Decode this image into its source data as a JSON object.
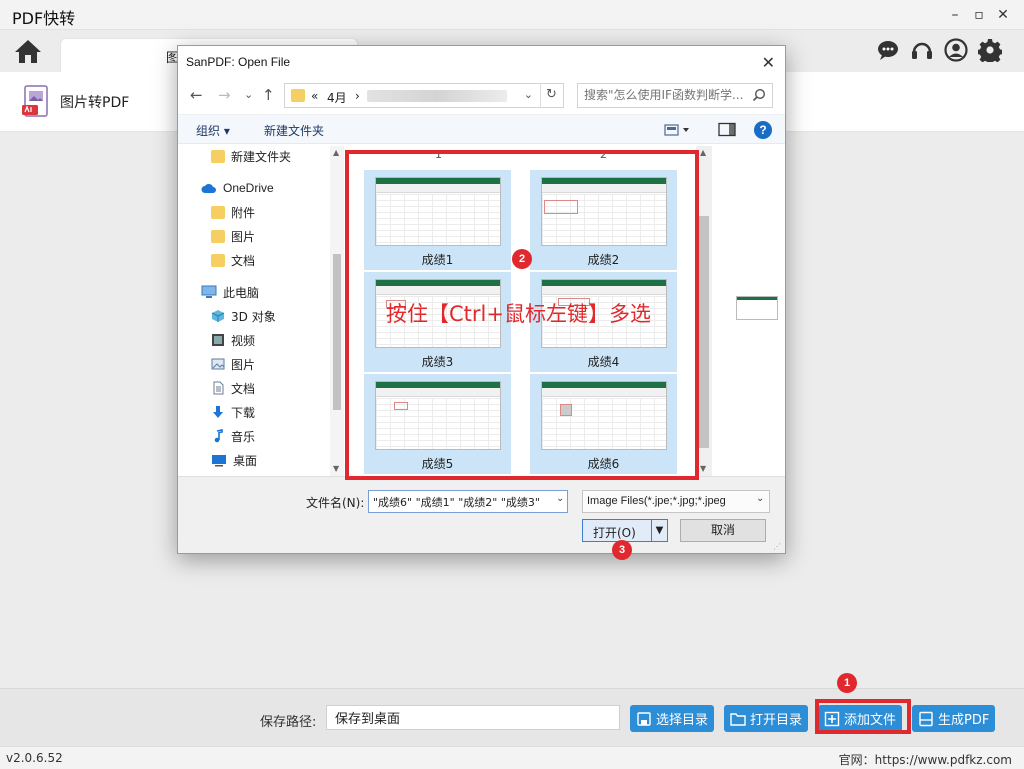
{
  "app": {
    "title": "PDF快转",
    "tab_label": "图片转PDF",
    "tool_label": "图片转PDF",
    "minimize": "–",
    "maximize": "▫",
    "close": "✕"
  },
  "dialog": {
    "title": "SanPDF: Open File",
    "close_glyph": "✕",
    "nav": {
      "back": "←",
      "forward": "→",
      "up": "↑",
      "recent": "⌄",
      "refresh": "↻"
    },
    "address": {
      "prefix": "«",
      "folder": "4月",
      "separator": "›",
      "dropdown": "⌄"
    },
    "search_placeholder": "搜索\"怎么使用IF函数判断学...",
    "commands": {
      "organize": "组织 ▾",
      "new_folder": "新建文件夹"
    },
    "sidebar": [
      {
        "label": "新建文件夹",
        "icon": "folder-icon"
      },
      {
        "label": "OneDrive",
        "icon": "cloud-icon"
      },
      {
        "label": "附件",
        "icon": "folder-icon"
      },
      {
        "label": "图片",
        "icon": "folder-icon"
      },
      {
        "label": "文档",
        "icon": "folder-icon"
      },
      {
        "label": "此电脑",
        "icon": "computer-icon"
      },
      {
        "label": "3D 对象",
        "icon": "cube-icon"
      },
      {
        "label": "视频",
        "icon": "video-icon"
      },
      {
        "label": "图片",
        "icon": "picture-icon"
      },
      {
        "label": "文档",
        "icon": "document-icon"
      },
      {
        "label": "下载",
        "icon": "download-icon"
      },
      {
        "label": "音乐",
        "icon": "music-icon"
      },
      {
        "label": "桌面",
        "icon": "desktop-icon"
      }
    ],
    "column_labels": [
      "1",
      "2"
    ],
    "files": [
      {
        "name": "成绩1",
        "selected": true
      },
      {
        "name": "成绩2",
        "selected": true
      },
      {
        "name": "成绩3",
        "selected": true
      },
      {
        "name": "成绩4",
        "selected": true
      },
      {
        "name": "成绩5",
        "selected": true
      },
      {
        "name": "成绩6",
        "selected": true
      }
    ],
    "filename_label": "文件名(N):",
    "filename_value": "\"成绩6\" \"成绩1\" \"成绩2\" \"成绩3\"",
    "filetype_value": "Image Files(*.jpe;*.jpg;*.jpeg",
    "open_label": "打开(O)",
    "open_split": "▼",
    "cancel_label": "取消"
  },
  "annotation": {
    "text": "按住【Ctrl+鼠标左键】多选",
    "badges": [
      "1",
      "2",
      "3"
    ],
    "color": "#e0292e"
  },
  "bottom": {
    "save_path_label": "保存路径:",
    "save_path_value": "保存到桌面",
    "choose_dir": "选择目录",
    "open_dir": "打开目录",
    "add_file": "添加文件",
    "generate_pdf": "生成PDF",
    "accent": "#2d8ed8"
  },
  "status": {
    "version": "v2.0.6.52",
    "website": "官网：https://www.pdfkz.com"
  }
}
